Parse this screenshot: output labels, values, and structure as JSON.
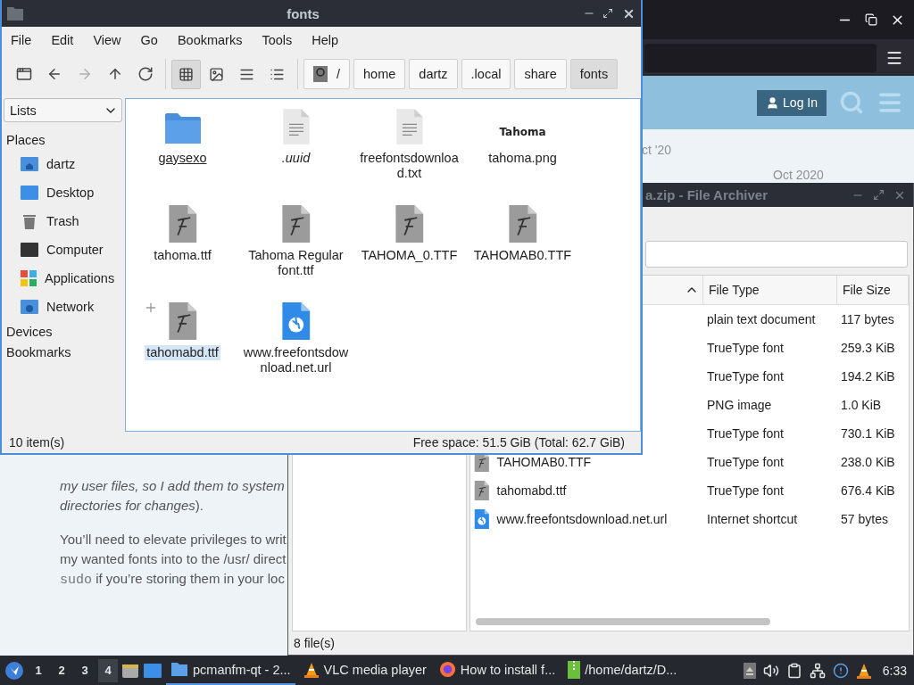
{
  "browser": {
    "login_button": "Log In",
    "dates": [
      "ct '20",
      "Oct 2020"
    ],
    "paragraphs": [
      [
        [
          {
            "text": "my user files, so I add them to system",
            "kind": "italic"
          }
        ],
        [
          {
            "text": "directories for changes",
            "kind": "italic"
          },
          {
            "text": ").",
            "kind": "plain"
          }
        ]
      ],
      [
        [
          {
            "text": "You’ll need to elevate privileges to writ",
            "kind": "plain"
          }
        ],
        [
          {
            "text": "my wanted fonts into to the /usr/ direct",
            "kind": "plain"
          }
        ],
        [
          {
            "text": "sudo",
            "kind": "code"
          },
          {
            "text": " if you’re storing them in your loc",
            "kind": "plain"
          }
        ]
      ]
    ]
  },
  "archiver": {
    "title": "a.zip - File Archiver",
    "columns": [
      "File Type",
      "File Size"
    ],
    "rows": [
      {
        "type": "plain text document",
        "size": "117 bytes"
      },
      {
        "type": "TrueType font",
        "size": "259.3 KiB"
      },
      {
        "type": "TrueType font",
        "size": "194.2 KiB"
      },
      {
        "type": "PNG image",
        "size": "1.0 KiB"
      },
      {
        "type": "TrueType font",
        "size": "730.1 KiB"
      },
      {
        "kind": "font",
        "name": "TAHOMAB0.TTF",
        "type": "TrueType font",
        "size": "238.0 KiB"
      },
      {
        "kind": "font",
        "name": "tahomabd.ttf",
        "type": "TrueType font",
        "size": "676.4 KiB"
      },
      {
        "kind": "url",
        "name": "www.freefontsdownload.net.url",
        "type": "Internet shortcut",
        "size": "57 bytes"
      }
    ],
    "status": "8 file(s)"
  },
  "file_manager": {
    "title": "fonts",
    "menu": [
      "File",
      "Edit",
      "View",
      "Go",
      "Bookmarks",
      "Tools",
      "Help"
    ],
    "nav": [
      {
        "kind": "new-window",
        "disabled": false
      },
      {
        "kind": "back",
        "disabled": false
      },
      {
        "kind": "forward",
        "disabled": true
      },
      {
        "kind": "up",
        "disabled": false
      },
      {
        "kind": "reload",
        "disabled": false
      }
    ],
    "views": [
      {
        "kind": "icons",
        "selected": true
      },
      {
        "kind": "thumbnails",
        "selected": false
      },
      {
        "kind": "compact",
        "selected": false
      },
      {
        "kind": "detailed",
        "selected": false
      }
    ],
    "path": [
      {
        "label": "/",
        "kind": "root",
        "selected": false
      },
      {
        "label": "home",
        "selected": false
      },
      {
        "label": "dartz",
        "selected": false
      },
      {
        "label": ".local",
        "selected": false
      },
      {
        "label": "share",
        "selected": false
      },
      {
        "label": "fonts",
        "selected": true
      }
    ],
    "side_mode": "Lists",
    "sections": [
      {
        "title": "Places",
        "items": [
          {
            "label": "dartz",
            "kind": "home"
          },
          {
            "label": "Desktop",
            "kind": "desktop"
          },
          {
            "label": "Trash",
            "kind": "trash"
          },
          {
            "label": "Computer",
            "kind": "computer"
          },
          {
            "label": "Applications",
            "kind": "apps"
          },
          {
            "label": "Network",
            "kind": "network"
          }
        ]
      },
      {
        "title": "Devices"
      },
      {
        "title": "Bookmarks"
      }
    ],
    "files": [
      {
        "name": "gaysexo",
        "kind": "folder",
        "selected": false,
        "hovered": true,
        "hidden": false
      },
      {
        "name": ".uuid",
        "kind": "text",
        "selected": false,
        "hovered": false,
        "hidden": true
      },
      {
        "name": "freefontsdownload.txt",
        "kind": "text",
        "selected": false,
        "hovered": false,
        "hidden": false
      },
      {
        "name": "tahoma.png",
        "kind": "image",
        "thumbnail_text": "Tahoma",
        "selected": false,
        "hovered": false,
        "hidden": false
      },
      {
        "name": "tahoma.ttf",
        "kind": "font",
        "selected": false,
        "hovered": false,
        "hidden": false
      },
      {
        "name": "Tahoma Regular font.ttf",
        "kind": "font",
        "selected": false,
        "hovered": false,
        "hidden": false
      },
      {
        "name": "TAHOMA_0.TTF",
        "kind": "font",
        "selected": false,
        "hovered": false,
        "hidden": false
      },
      {
        "name": "TAHOMAB0.TTF",
        "kind": "font",
        "selected": false,
        "hovered": false,
        "hidden": false
      },
      {
        "name": "tahomabd.ttf",
        "kind": "font",
        "selected": true,
        "hovered": false,
        "hidden": false
      },
      {
        "name": "www.freefontsdownload.net.url",
        "kind": "url",
        "selected": false,
        "hovered": false,
        "hidden": false
      }
    ],
    "status": "10 item(s)",
    "free_space": "Free space: 51.5 GiB (Total: 62.7 GiB)"
  },
  "taskbar": {
    "workspaces": [
      {
        "label": "1",
        "selected": false
      },
      {
        "label": "2",
        "selected": false
      },
      {
        "label": "3",
        "selected": false
      },
      {
        "label": "4",
        "selected": true
      }
    ],
    "tasks": [
      {
        "label": "pcmanfm-qt - 2...",
        "kind": "files",
        "selected": true
      },
      {
        "label": "VLC media player",
        "kind": "vlc",
        "selected": false
      },
      {
        "label": "How to install f...",
        "kind": "firefox",
        "selected": false
      },
      {
        "label": "/home/dartz/D...",
        "kind": "archive",
        "selected": false
      }
    ],
    "clock": "6:33"
  }
}
